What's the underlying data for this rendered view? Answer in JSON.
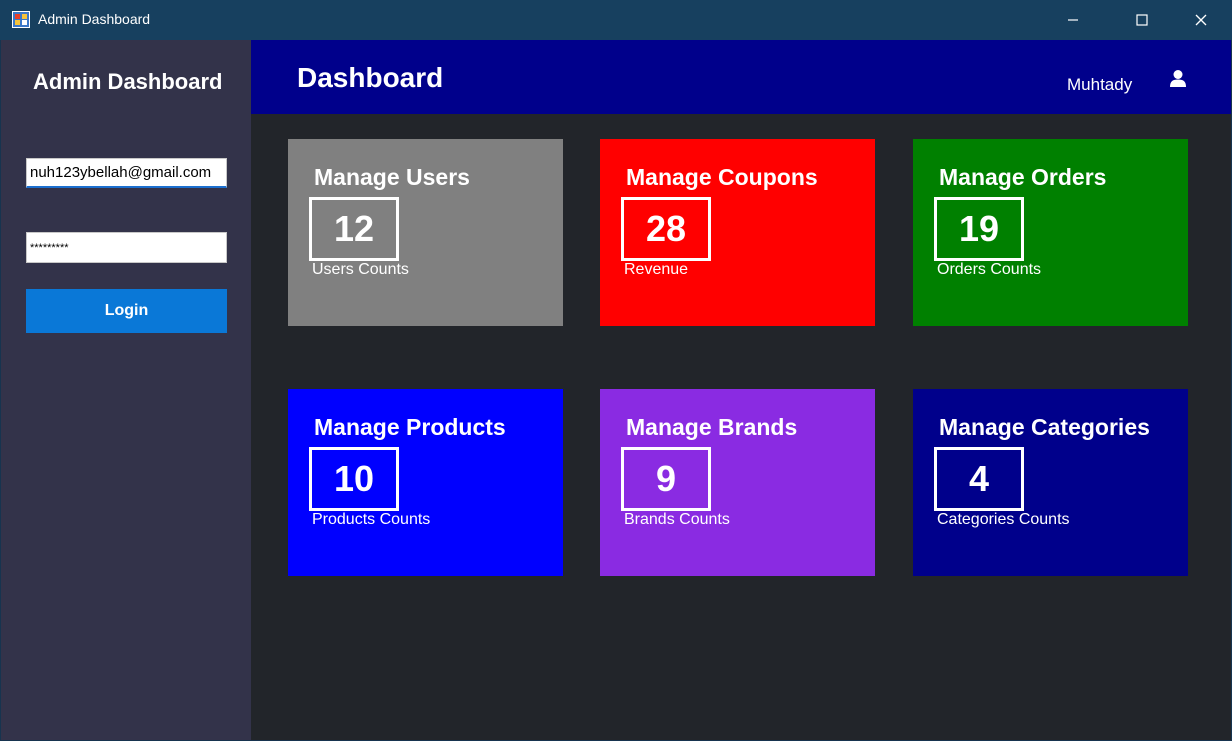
{
  "window": {
    "title": "Admin Dashboard",
    "title_bar_color": "#17405f"
  },
  "sidebar": {
    "title": "Admin Dashboard",
    "email_value": "nuh123ybellah@gmail.com",
    "password_value": "*********",
    "login_label": "Login",
    "background": "#33334a",
    "login_color": "#0a78d7"
  },
  "header": {
    "title": "Dashboard",
    "username": "Muhtady",
    "user_icon": "user-icon",
    "background": "#00008b"
  },
  "cards": [
    {
      "title": "Manage Users",
      "count": "12",
      "subtitle": "Users Counts",
      "color": "#808080"
    },
    {
      "title": "Manage Coupons",
      "count": "28",
      "subtitle": "Revenue",
      "color": "#ff0000"
    },
    {
      "title": "Manage Orders",
      "count": "19",
      "subtitle": "Orders Counts",
      "color": "#008000"
    },
    {
      "title": "Manage Products",
      "count": "10",
      "subtitle": "Products Counts",
      "color": "#0000ff"
    },
    {
      "title": "Manage Brands",
      "count": "9",
      "subtitle": "Brands Counts",
      "color": "#8a2be2"
    },
    {
      "title": "Manage Categories",
      "count": "4",
      "subtitle": "Categories Counts",
      "color": "#00008b"
    }
  ]
}
